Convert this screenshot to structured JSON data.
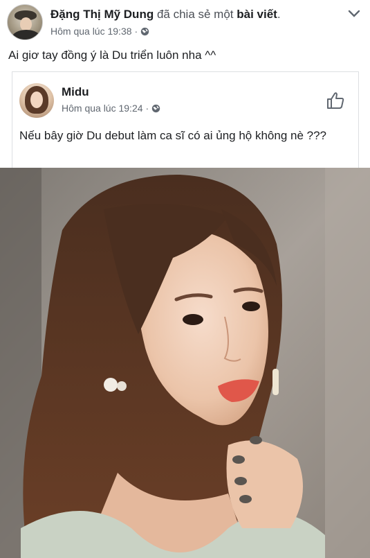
{
  "post": {
    "author": "Đặng Thị Mỹ Dung",
    "share_verb": "đã chia sẻ một",
    "share_object": "bài viết",
    "share_end": ".",
    "timestamp": "Hôm qua lúc 19:38",
    "separator": "·",
    "privacy_icon": "globe-icon",
    "text": "Ai giơ tay đồng ý là Du triển luôn nha ^^"
  },
  "shared": {
    "author": "Midu",
    "timestamp": "Hôm qua lúc 19:24",
    "separator": "·",
    "privacy_icon": "globe-icon",
    "text": "Nếu bây giờ Du debut làm ca sĩ có ai ủng hộ không nè ???",
    "like_icon": "thumbs-up-icon"
  },
  "colors": {
    "text": "#1c1e21",
    "meta": "#606770",
    "border": "#dddfe2"
  }
}
